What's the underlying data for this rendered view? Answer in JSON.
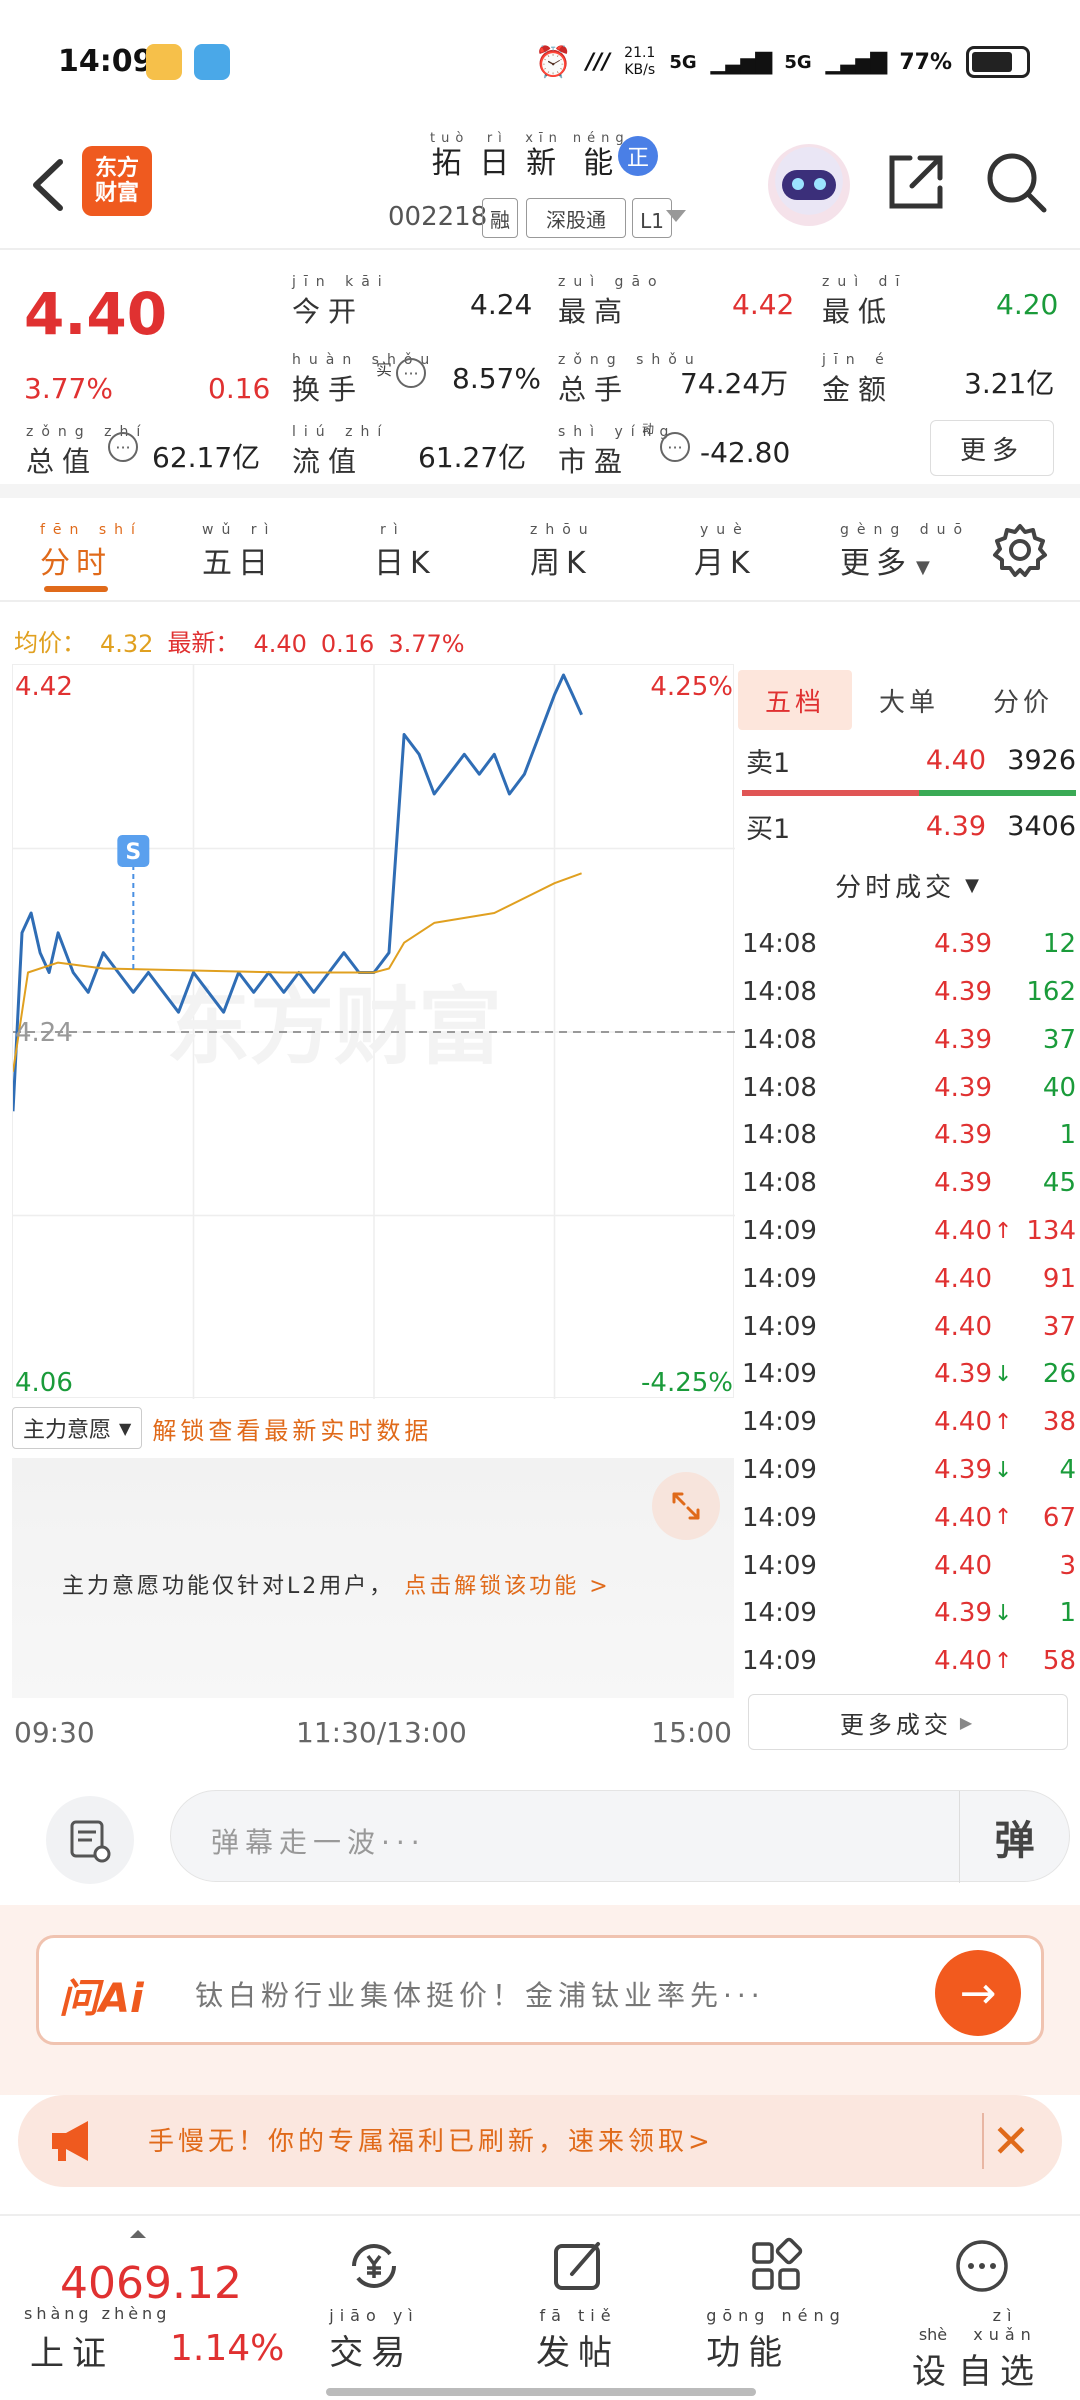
{
  "status_bar": {
    "time": "14:09",
    "net_speed": "21.1\nKB/s",
    "net_speed_top": "21.1",
    "net_speed_unit": "KB/s",
    "signal1": "5G",
    "signal2": "5G",
    "battery": "77%",
    "battery_level": 0.77
  },
  "header": {
    "app_logo": "东方\n财富",
    "app_logo_line1": "东方",
    "app_logo_line2": "财富",
    "stock_name": "拓日新能",
    "stock_name_pinyin": [
      "tuò",
      "rì",
      "xīn",
      "néng"
    ],
    "badge": "正",
    "stock_code": "002218",
    "tags": [
      {
        "text": "融",
        "pinyin": "róng"
      },
      {
        "text": "深股通",
        "pinyin": "shēn gǔ tōng"
      },
      {
        "text": "L1",
        "pinyin": ""
      }
    ]
  },
  "quote": {
    "last_price": "4.40",
    "change_pct": "3.77%",
    "change_amt": "0.16",
    "fields": {
      "open_label": "今开",
      "open_pinyin": "jīn kāi",
      "open": "4.24",
      "high_label": "最高",
      "high_pinyin": "zuì gāo",
      "high": "4.42",
      "low_label": "最低",
      "low_pinyin": "zuì dī",
      "low": "4.20",
      "turnover_label": "换手",
      "turnover_pinyin": "huàn shǒu",
      "turnover_note": "实",
      "turnover": "8.57%",
      "volume_label": "总手",
      "volume_pinyin": "zǒng shǒu",
      "volume": "74.24万",
      "amount_label": "金额",
      "amount_pinyin": "jīn é",
      "amount": "3.21亿",
      "mktcap_label": "总值",
      "mktcap_pinyin": "zǒng zhí",
      "mktcap": "62.17亿",
      "float_label": "流值",
      "float_pinyin": "liú zhí",
      "float": "61.27亿",
      "pe_label": "市盈",
      "pe_pinyin": "shì yíng",
      "pe_note": "动",
      "pe": "-42.80"
    },
    "more_button": "更多"
  },
  "tabs": {
    "items": [
      {
        "label": "分时",
        "pinyin": "fēn shí"
      },
      {
        "label": "五日",
        "pinyin": "wǔ rì"
      },
      {
        "label": "日K",
        "pinyin": "rì"
      },
      {
        "label": "周K",
        "pinyin": "zhōu"
      },
      {
        "label": "月K",
        "pinyin": "yuè"
      },
      {
        "label": "更多",
        "pinyin": "gèng duō"
      }
    ]
  },
  "avg_row": {
    "avg_label": "均价：",
    "avg_value": "4.32",
    "latest_label": "最新：",
    "latest_value": "4.40",
    "change_amt": "0.16",
    "change_pct": "3.77%"
  },
  "chart_data": {
    "type": "line",
    "title": "",
    "y_left_top": "4.42",
    "y_left_bottom": "4.06",
    "y_right_top": "4.25%",
    "y_right_bottom": "-4.25%",
    "prev_close_label": "4.24",
    "prev_close": 4.24,
    "ylim": [
      4.06,
      4.42
    ],
    "x_ticks": [
      "09:30",
      "11:30/13:00",
      "15:00"
    ],
    "watermark": "东方财富",
    "marker": "S",
    "series": [
      {
        "name": "",
        "color": "#2f6db5",
        "x": [
          "09:30",
          "09:33",
          "09:36",
          "09:39",
          "09:42",
          "09:45",
          "09:50",
          "09:55",
          "10:00",
          "10:05",
          "10:10",
          "10:15",
          "10:20",
          "10:25",
          "10:30",
          "10:35",
          "10:40",
          "10:45",
          "10:50",
          "10:55",
          "11:00",
          "11:05",
          "11:10",
          "11:15",
          "11:20",
          "11:25",
          "11:30",
          "13:05",
          "13:10",
          "13:15",
          "13:20",
          "13:25",
          "13:30",
          "13:35",
          "13:40",
          "13:45",
          "13:50",
          "13:55",
          "14:00",
          "14:03",
          "14:06",
          "14:09"
        ],
        "values": [
          4.2,
          4.29,
          4.3,
          4.28,
          4.27,
          4.29,
          4.27,
          4.26,
          4.28,
          4.27,
          4.26,
          4.27,
          4.26,
          4.25,
          4.27,
          4.26,
          4.25,
          4.27,
          4.26,
          4.27,
          4.26,
          4.27,
          4.26,
          4.27,
          4.28,
          4.27,
          4.27,
          4.28,
          4.39,
          4.38,
          4.36,
          4.37,
          4.38,
          4.37,
          4.38,
          4.36,
          4.37,
          4.39,
          4.41,
          4.42,
          4.41,
          4.4
        ]
      },
      {
        "name": "",
        "color": "#e0a020",
        "x": [
          "09:30",
          "09:35",
          "09:45",
          "10:00",
          "10:30",
          "11:00",
          "11:30",
          "13:05",
          "13:10",
          "13:20",
          "13:40",
          "14:00",
          "14:09"
        ],
        "values": [
          4.22,
          4.27,
          4.275,
          4.272,
          4.271,
          4.27,
          4.27,
          4.272,
          4.285,
          4.295,
          4.3,
          4.315,
          4.32
        ]
      }
    ]
  },
  "main_intent": {
    "select_label": "主力意愿",
    "select_pinyin": "zhǔ lì yì yuàn",
    "unlock_text": "解锁查看最新实时数据",
    "l2_text": "主力意愿功能仅针对L2用户，",
    "l2_link": "点击解锁该功能"
  },
  "depth": {
    "tabs": [
      "五档",
      "大单",
      "分价"
    ],
    "ask": {
      "label": "卖1",
      "price": "4.40",
      "vol": "3926"
    },
    "bid": {
      "label": "买1",
      "price": "4.39",
      "vol": "3406"
    },
    "buy_ratio": 0.53,
    "trades_title": "分时成交",
    "trades": [
      {
        "t": "14:08",
        "p": "4.39",
        "dir": "",
        "v": "12",
        "vc": "green"
      },
      {
        "t": "14:08",
        "p": "4.39",
        "dir": "",
        "v": "162",
        "vc": "green"
      },
      {
        "t": "14:08",
        "p": "4.39",
        "dir": "",
        "v": "37",
        "vc": "green"
      },
      {
        "t": "14:08",
        "p": "4.39",
        "dir": "",
        "v": "40",
        "vc": "green"
      },
      {
        "t": "14:08",
        "p": "4.39",
        "dir": "",
        "v": "1",
        "vc": "green"
      },
      {
        "t": "14:08",
        "p": "4.39",
        "dir": "",
        "v": "45",
        "vc": "green"
      },
      {
        "t": "14:09",
        "p": "4.40",
        "dir": "↑",
        "v": "134",
        "vc": "red"
      },
      {
        "t": "14:09",
        "p": "4.40",
        "dir": "",
        "v": "91",
        "vc": "red"
      },
      {
        "t": "14:09",
        "p": "4.40",
        "dir": "",
        "v": "37",
        "vc": "red"
      },
      {
        "t": "14:09",
        "p": "4.39",
        "dir": "↓",
        "v": "26",
        "vc": "green"
      },
      {
        "t": "14:09",
        "p": "4.40",
        "dir": "↑",
        "v": "38",
        "vc": "red"
      },
      {
        "t": "14:09",
        "p": "4.39",
        "dir": "↓",
        "v": "4",
        "vc": "green"
      },
      {
        "t": "14:09",
        "p": "4.40",
        "dir": "↑",
        "v": "67",
        "vc": "red"
      },
      {
        "t": "14:09",
        "p": "4.40",
        "dir": "",
        "v": "3",
        "vc": "red"
      },
      {
        "t": "14:09",
        "p": "4.39",
        "dir": "↓",
        "v": "1",
        "vc": "green"
      },
      {
        "t": "14:09",
        "p": "4.40",
        "dir": "↑",
        "v": "58",
        "vc": "red"
      }
    ],
    "more_trades": "更多成交"
  },
  "comment": {
    "placeholder": "弹幕走一波···",
    "danmu_toggle": "弹"
  },
  "ask_ai": {
    "logo": "问Ai",
    "text": "钛白粉行业集体挺价！金浦钛业率先···"
  },
  "promo": {
    "text": "手慢无！你的专属福利已刷新，速来领取>"
  },
  "bottom_nav": {
    "index_value": "4069.12",
    "index_name": "上证",
    "index_pinyin": "shàng zhèng",
    "index_change": "1.14%",
    "items": [
      {
        "label": "交易",
        "pinyin": "jiāo yì",
        "icon": "yuan-exchange-icon"
      },
      {
        "label": "发帖",
        "pinyin": "fā tiě",
        "icon": "edit-post-icon"
      },
      {
        "label": "功能",
        "pinyin": "gōng néng",
        "icon": "grid-apps-icon"
      },
      {
        "label": "自选",
        "pinyin": "zì xuǎn",
        "icon": "more-dots-icon"
      }
    ],
    "last_item_prefix": "设",
    "last_item_prefix_pinyin": "shè"
  },
  "colors": {
    "up": "#e03131",
    "down": "#1a9b3a",
    "accent": "#e06a1a",
    "price_line": "#2f6db5",
    "avg_line": "#e0a020"
  }
}
